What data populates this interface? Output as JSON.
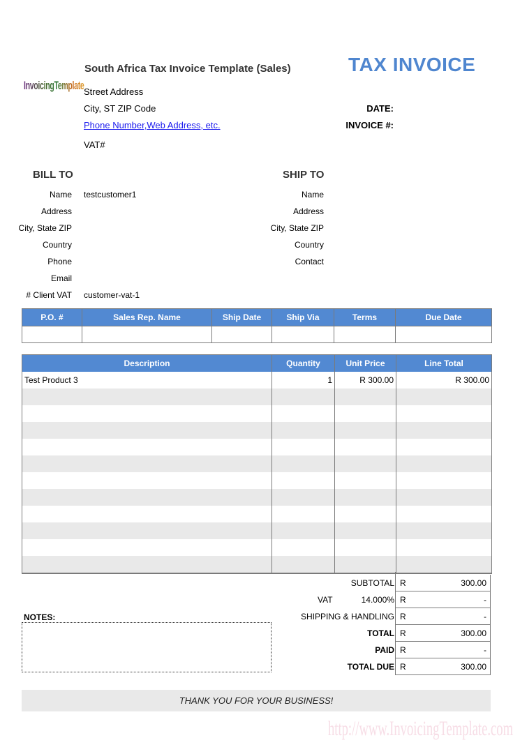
{
  "header": {
    "company_title": "South Africa Tax Invoice Template (Sales)",
    "doc_title": "TAX INVOICE",
    "logo_text": "InvoicingTemplate",
    "street": "Street Address",
    "city_line": "City, ST  ZIP Code",
    "contact_link": "Phone Number,Web Address, etc.",
    "vat_label": "VAT#",
    "date_label": "DATE:",
    "date_value": "",
    "invoice_label": "INVOICE #:",
    "invoice_value": ""
  },
  "bill_to": {
    "title": "BILL TO",
    "fields": [
      {
        "label": "Name",
        "value": "testcustomer1"
      },
      {
        "label": "Address",
        "value": ""
      },
      {
        "label": "City, State ZIP",
        "value": ""
      },
      {
        "label": "Country",
        "value": ""
      },
      {
        "label": "Phone",
        "value": ""
      },
      {
        "label": "Email",
        "value": ""
      },
      {
        "label": "Client VAT #",
        "value": "customer-vat-1"
      }
    ]
  },
  "ship_to": {
    "title": "SHIP TO",
    "fields": [
      {
        "label": "Name",
        "value": ""
      },
      {
        "label": "Address",
        "value": ""
      },
      {
        "label": "City, State ZIP",
        "value": ""
      },
      {
        "label": "Country",
        "value": ""
      },
      {
        "label": "Contact",
        "value": ""
      }
    ]
  },
  "info_table": {
    "headers": [
      "P.O. #",
      "Sales Rep. Name",
      "Ship Date",
      "Ship Via",
      "Terms",
      "Due Date"
    ],
    "values": [
      "",
      "",
      "",
      "",
      "",
      ""
    ]
  },
  "items_table": {
    "headers": [
      "Description",
      "Quantity",
      "Unit Price",
      "Line Total"
    ],
    "rows": [
      [
        "Test Product 3",
        "1",
        "R 300.00",
        "R 300.00"
      ],
      [
        "",
        "",
        "",
        ""
      ],
      [
        "",
        "",
        "",
        ""
      ],
      [
        "",
        "",
        "",
        ""
      ],
      [
        "",
        "",
        "",
        ""
      ],
      [
        "",
        "",
        "",
        ""
      ],
      [
        "",
        "",
        "",
        ""
      ],
      [
        "",
        "",
        "",
        ""
      ],
      [
        "",
        "",
        "",
        ""
      ],
      [
        "",
        "",
        "",
        ""
      ],
      [
        "",
        "",
        "",
        ""
      ],
      [
        "",
        "",
        "",
        ""
      ]
    ]
  },
  "totals": [
    {
      "label": "SUBTOTAL",
      "bold": false,
      "currency": "R",
      "value": "300.00"
    },
    {
      "label": "VAT",
      "rate": "14.000%",
      "bold": false,
      "currency": "R",
      "value": "-"
    },
    {
      "label": "SHIPPING & HANDLING",
      "bold": false,
      "currency": "R",
      "value": "-"
    },
    {
      "label": "TOTAL",
      "bold": true,
      "currency": "R",
      "value": "300.00"
    },
    {
      "label": "PAID",
      "bold": true,
      "currency": "R",
      "value": "-"
    },
    {
      "label": "TOTAL DUE",
      "bold": true,
      "currency": "R",
      "value": "300.00"
    }
  ],
  "notes": {
    "label": "NOTES:",
    "value": ""
  },
  "footer": {
    "thanks": "THANK YOU FOR YOUR BUSINESS!",
    "watermark": "http://www.InvoicingTemplate.com"
  },
  "colors": {
    "accent": "#5289d2",
    "title_blue": "#4f86cf",
    "row_stripe": "#e9e9e9",
    "border": "#7a7a7a"
  }
}
